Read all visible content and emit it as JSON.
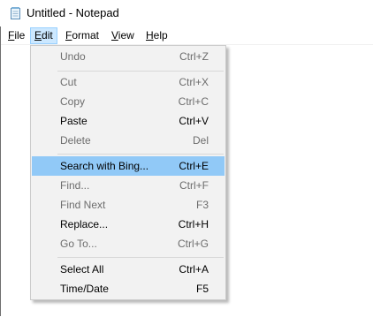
{
  "window": {
    "title": "Untitled - Notepad",
    "icon": "notepad-icon"
  },
  "menubar": {
    "items": [
      {
        "label": "File",
        "accel": "F",
        "rest": "ile"
      },
      {
        "label": "Edit",
        "accel": "E",
        "rest": "dit",
        "active": true
      },
      {
        "label": "Format",
        "accel": "F",
        "rest": "ormat"
      },
      {
        "label": "View",
        "accel": "V",
        "rest": "iew"
      },
      {
        "label": "Help",
        "accel": "H",
        "rest": "elp"
      }
    ]
  },
  "edit_menu": {
    "items": [
      {
        "label": "Undo",
        "shortcut": "Ctrl+Z",
        "enabled": false
      },
      {
        "label": "Cut",
        "shortcut": "Ctrl+X",
        "enabled": false
      },
      {
        "label": "Copy",
        "shortcut": "Ctrl+C",
        "enabled": false
      },
      {
        "label": "Paste",
        "shortcut": "Ctrl+V",
        "enabled": true
      },
      {
        "label": "Delete",
        "shortcut": "Del",
        "enabled": false
      },
      {
        "label": "Search with Bing...",
        "shortcut": "Ctrl+E",
        "enabled": true,
        "highlighted": true
      },
      {
        "label": "Find...",
        "shortcut": "Ctrl+F",
        "enabled": false
      },
      {
        "label": "Find Next",
        "shortcut": "F3",
        "enabled": false
      },
      {
        "label": "Replace...",
        "shortcut": "Ctrl+H",
        "enabled": true
      },
      {
        "label": "Go To...",
        "shortcut": "Ctrl+G",
        "enabled": false
      },
      {
        "label": "Select All",
        "shortcut": "Ctrl+A",
        "enabled": true
      },
      {
        "label": "Time/Date",
        "shortcut": "F5",
        "enabled": true
      }
    ]
  },
  "colors": {
    "menu_active_bg": "#cce8ff",
    "menu_item_highlight": "#91c9f7",
    "disabled_text": "#6d6d6d"
  }
}
